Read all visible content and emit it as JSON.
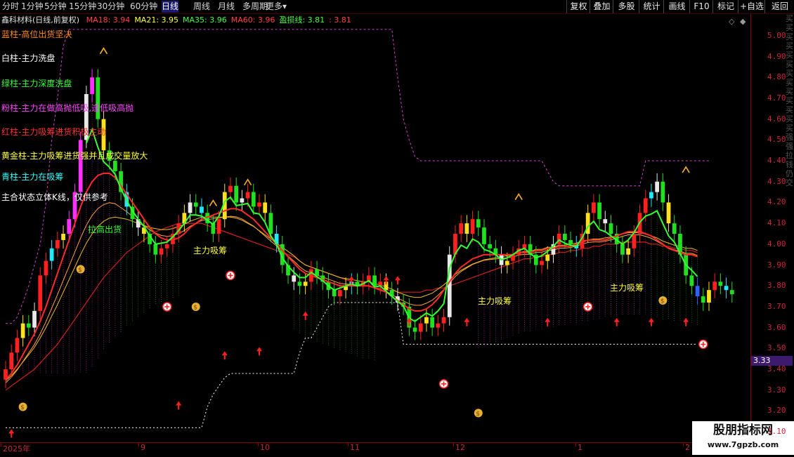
{
  "toolbar": {
    "periods": [
      "分时",
      "1分钟",
      "5分钟",
      "15分钟",
      "30分钟",
      "60分钟",
      "日线",
      "周线",
      "月线",
      "多周期",
      "更多▾"
    ],
    "active_period": "日线",
    "buttons": [
      "复权",
      "叠加",
      "多股",
      "统计",
      "画线",
      "F10",
      "标记",
      "+自选",
      "返回"
    ]
  },
  "header": {
    "stock_title": "鑫科材料(日线,前复权)",
    "ma": [
      {
        "label": "MA18: 3.94",
        "color": "#ff4040"
      },
      {
        "label": "MA21: 3.95",
        "color": "#ffff40"
      },
      {
        "label": "MA35: 3.96",
        "color": "#40ff40"
      },
      {
        "label": "MA60: 3.96",
        "color": "#ff4040"
      },
      {
        "label": "盈损线: 3.81",
        "color": "#40ff40"
      },
      {
        "label": ": 3.81",
        "color": "#ff4040"
      }
    ]
  },
  "legend": [
    {
      "text": "蓝柱-高位出货坚决",
      "color": "#ff8c1a"
    },
    {
      "text": "白柱-主力洗盘",
      "color": "#ffffff"
    },
    {
      "text": "绿柱-主力深度洗盘",
      "color": "#33ff33"
    },
    {
      "text": "粉柱-主力在做高抛低吸,逢低吸高抛",
      "color": "#ff44ff"
    },
    {
      "text": "红柱-主力吸筹进货积极主动",
      "color": "#ff3333"
    },
    {
      "text": "黄金柱-主力吸筹进货强并且成交量放大",
      "color": "#ffff33"
    },
    {
      "text": "青柱-主力在吸筹",
      "color": "#33ffff"
    },
    {
      "text": "主合状态立体K线，仅供参考",
      "color": "#ffffff"
    }
  ],
  "annotations": [
    {
      "text": "拉高出货",
      "color": "#33ff33"
    },
    {
      "text": "主力吸筹",
      "color": "#ffff33"
    },
    {
      "text": "主力吸筹",
      "color": "#ffff33"
    },
    {
      "text": "主力吸筹",
      "color": "#ffff33"
    }
  ],
  "current_price": "3.33",
  "controls": {
    "diamond": "◇",
    "arrows": "◆"
  },
  "watermark": {
    "title": "股朋指标网",
    "url": "www.7gpzb.com"
  },
  "right_strip_text": "买买买买买买买买买买买买买强强拉钱仍交",
  "chart_data": {
    "type": "candlestick",
    "y_ticks": [
      "5.00",
      "4.90",
      "4.80",
      "4.70",
      "4.60",
      "4.50",
      "4.40",
      "4.30",
      "4.20",
      "4.10",
      "4.00",
      "3.90",
      "3.80",
      "3.70",
      "3.60",
      "3.50",
      "3.40",
      "3.30",
      "3.20",
      "3.10"
    ],
    "ylim": [
      3.05,
      5.05
    ],
    "x_ticks": [
      "2025年",
      "9",
      "10",
      "11",
      "12",
      "1",
      "2"
    ],
    "colors": {
      "up": "#ff2020",
      "down": "#20e020",
      "gold": "#ffe020",
      "pink": "#ff30ff",
      "white": "#e8e8e8",
      "cyan": "#20e8ff",
      "blue": "#3060ff"
    },
    "closes": [
      3.4,
      3.48,
      3.55,
      3.62,
      3.6,
      3.68,
      3.85,
      3.92,
      3.98,
      4.02,
      4.05,
      4.12,
      4.25,
      4.5,
      4.72,
      4.8,
      4.6,
      4.45,
      4.4,
      4.35,
      4.25,
      4.18,
      4.12,
      4.08,
      4.05,
      4.0,
      3.95,
      3.98,
      4.0,
      4.05,
      4.1,
      4.15,
      4.2,
      4.18,
      4.15,
      4.1,
      4.05,
      4.12,
      4.25,
      4.28,
      4.2,
      4.22,
      4.25,
      4.18,
      4.2,
      4.15,
      4.05,
      4.0,
      3.9,
      3.85,
      3.82,
      3.8,
      3.82,
      3.88,
      3.85,
      3.82,
      3.78,
      3.75,
      3.78,
      3.8,
      3.82,
      3.8,
      3.82,
      3.85,
      3.8,
      3.82,
      3.78,
      3.75,
      3.72,
      3.7,
      3.6,
      3.58,
      3.62,
      3.65,
      3.6,
      3.62,
      3.65,
      3.95,
      4.05,
      4.1,
      4.05,
      4.12,
      4.08,
      4.0,
      3.98,
      3.95,
      3.9,
      3.92,
      3.95,
      3.98,
      4.0,
      3.95,
      3.9,
      3.92,
      3.95,
      4.0,
      4.05,
      4.02,
      4.0,
      3.98,
      4.05,
      4.15,
      4.2,
      4.12,
      4.1,
      4.05,
      4.0,
      3.95,
      3.98,
      4.05,
      4.15,
      4.22,
      4.25,
      4.3,
      4.2,
      4.1,
      4.05,
      3.95,
      3.85,
      3.8,
      3.75,
      3.72,
      3.78,
      3.82,
      3.8,
      3.78,
      3.76
    ],
    "ma18": [
      3.35,
      3.38,
      3.42,
      3.47,
      3.52,
      3.57,
      3.63,
      3.7,
      3.78,
      3.86,
      3.94,
      4.02,
      4.1,
      4.18,
      4.25,
      4.3,
      4.33,
      4.34,
      4.34,
      4.32,
      4.28,
      4.24,
      4.2,
      4.16,
      4.12,
      4.08,
      4.05,
      4.03,
      4.02,
      4.02,
      4.03,
      4.05,
      4.08,
      4.1,
      4.12,
      4.13,
      4.14,
      4.15,
      4.16,
      4.17,
      4.17,
      4.16,
      4.14,
      4.12,
      4.09,
      4.06,
      4.03,
      4.0,
      3.97,
      3.94,
      3.91,
      3.88,
      3.86,
      3.85,
      3.84,
      3.83,
      3.82,
      3.81,
      3.8,
      3.8,
      3.8,
      3.8,
      3.8,
      3.8,
      3.79,
      3.78,
      3.77,
      3.75,
      3.73,
      3.71,
      3.69,
      3.68,
      3.68,
      3.69,
      3.71,
      3.74,
      3.78,
      3.82,
      3.86,
      3.89,
      3.91,
      3.93,
      3.94,
      3.95,
      3.95,
      3.95,
      3.95,
      3.95,
      3.95,
      3.96,
      3.96,
      3.96,
      3.97,
      3.97,
      3.98,
      3.98,
      3.99,
      3.99,
      3.99,
      4.0,
      4.01,
      4.02,
      4.02,
      4.02,
      4.02,
      4.03,
      4.04,
      4.05,
      4.06,
      4.06,
      4.06,
      4.05,
      4.04,
      4.02,
      4.0,
      3.98,
      3.97,
      3.96,
      3.95,
      3.95,
      3.94
    ],
    "ma60": [
      3.3,
      3.32,
      3.34,
      3.36,
      3.38,
      3.4,
      3.43,
      3.46,
      3.49,
      3.52,
      3.56,
      3.6,
      3.64,
      3.68,
      3.72,
      3.76,
      3.8,
      3.84,
      3.87,
      3.9,
      3.93,
      3.96,
      3.98,
      4.0,
      4.02,
      4.04,
      4.06,
      4.07,
      4.08,
      4.09,
      4.1,
      4.1,
      4.1,
      4.1,
      4.1,
      4.09,
      4.08,
      4.07,
      4.06,
      4.05,
      4.04,
      4.03,
      4.02,
      4.01,
      4.0,
      3.99,
      3.98,
      3.97,
      3.96,
      3.95,
      3.94,
      3.92,
      3.9,
      3.89,
      3.88,
      3.87,
      3.86,
      3.85,
      3.84,
      3.83,
      3.82,
      3.81,
      3.8,
      3.8,
      3.79,
      3.79,
      3.78,
      3.78,
      3.77,
      3.77,
      3.77,
      3.77,
      3.77,
      3.78,
      3.78,
      3.79,
      3.79,
      3.8,
      3.81,
      3.82,
      3.83,
      3.84,
      3.85,
      3.86,
      3.87,
      3.88,
      3.89,
      3.9,
      3.91,
      3.92,
      3.93,
      3.93,
      3.94,
      3.94,
      3.95,
      3.95,
      3.96,
      3.96,
      3.97,
      3.97,
      3.98,
      3.98,
      3.99,
      3.99,
      4.0,
      4.0,
      4.0,
      4.01,
      4.01,
      4.01,
      4.01,
      4.01,
      4.0,
      4.0,
      3.99,
      3.99,
      3.98,
      3.98,
      3.97,
      3.97,
      3.96
    ],
    "support_line": [
      3.12,
      3.12,
      3.12,
      3.12,
      3.12,
      3.12,
      3.12,
      3.12,
      3.12,
      3.12,
      3.12,
      3.12,
      3.12,
      3.12,
      3.12,
      3.12,
      3.12,
      3.12,
      3.12,
      3.12,
      3.12,
      3.12,
      3.12,
      3.12,
      3.12,
      3.12,
      3.12,
      3.12,
      3.12,
      3.12,
      3.12,
      3.12,
      3.12,
      3.12,
      3.12,
      3.22,
      3.28,
      3.32,
      3.36,
      3.38,
      3.38,
      3.38,
      3.38,
      3.38,
      3.38,
      3.38,
      3.38,
      3.38,
      3.38,
      3.38,
      3.38,
      3.48,
      3.55,
      3.55,
      3.6,
      3.65,
      3.7,
      3.72,
      3.72,
      3.72,
      3.72,
      3.72,
      3.72,
      3.72,
      3.72,
      3.72,
      3.72,
      3.72,
      3.72,
      3.52,
      3.52,
      3.52,
      3.52,
      3.52,
      3.52,
      3.52,
      3.52,
      3.52,
      3.52,
      3.52,
      3.52,
      3.52,
      3.52,
      3.52,
      3.52,
      3.52,
      3.52,
      3.52,
      3.52,
      3.52,
      3.52,
      3.52,
      3.52,
      3.52,
      3.52,
      3.52,
      3.52,
      3.52,
      3.52,
      3.52,
      3.52,
      3.52,
      3.52,
      3.52,
      3.52,
      3.52,
      3.52,
      3.52,
      3.52,
      3.52,
      3.52,
      3.52,
      3.52,
      3.52,
      3.52,
      3.52,
      3.52,
      3.52,
      3.52,
      3.52,
      3.52
    ],
    "resistance_line": [
      3.62,
      3.62,
      3.65,
      3.72,
      3.8,
      3.9,
      4.0,
      4.2,
      4.5,
      4.7,
      4.95,
      5.03,
      5.03,
      5.03,
      5.03,
      5.03,
      5.03,
      5.03,
      5.03,
      5.03,
      5.03,
      5.03,
      5.03,
      5.03,
      5.03,
      5.03,
      5.03,
      5.03,
      5.03,
      5.03,
      5.03,
      5.03,
      5.03,
      5.03,
      5.03,
      5.03,
      5.03,
      5.03,
      5.03,
      5.03,
      5.03,
      5.03,
      5.03,
      5.03,
      5.03,
      5.03,
      5.03,
      5.03,
      5.03,
      5.03,
      5.03,
      5.03,
      5.03,
      5.03,
      5.03,
      5.03,
      5.03,
      5.03,
      5.03,
      5.03,
      5.03,
      5.03,
      5.03,
      5.03,
      5.03,
      5.03,
      5.03,
      5.03,
      4.8,
      4.6,
      4.5,
      4.42,
      4.4,
      4.4,
      4.4,
      4.4,
      4.4,
      4.4,
      4.4,
      4.4,
      4.4,
      4.4,
      4.4,
      4.4,
      4.4,
      4.4,
      4.4,
      4.4,
      4.4,
      4.4,
      4.4,
      4.4,
      4.4,
      4.4,
      4.35,
      4.3,
      4.28,
      4.28,
      4.28,
      4.28,
      4.28,
      4.28,
      4.28,
      4.28,
      4.28,
      4.28,
      4.28,
      4.28,
      4.28,
      4.28,
      4.28,
      4.4,
      4.4,
      4.4,
      4.4,
      4.4,
      4.4,
      4.4,
      4.4,
      4.4,
      4.4,
      4.4,
      4.4
    ]
  }
}
